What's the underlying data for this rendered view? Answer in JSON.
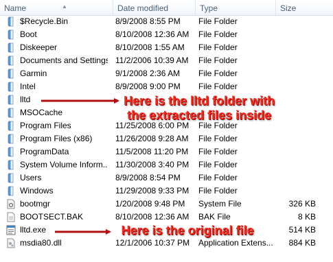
{
  "columns": {
    "name": "Name",
    "date": "Date modified",
    "type": "Type",
    "size": "Size"
  },
  "files": [
    {
      "name": "$Recycle.Bin",
      "date": "8/9/2008 8:55 PM",
      "type": "File Folder",
      "size": "",
      "icon": "folder-icon"
    },
    {
      "name": "Boot",
      "date": "8/10/2008 12:36 AM",
      "type": "File Folder",
      "size": "",
      "icon": "folder-icon"
    },
    {
      "name": "Diskeeper",
      "date": "8/10/2008 1:55 AM",
      "type": "File Folder",
      "size": "",
      "icon": "folder-icon"
    },
    {
      "name": "Documents and Settings",
      "date": "11/2/2006 10:39 AM",
      "type": "File Folder",
      "size": "",
      "icon": "folder-icon"
    },
    {
      "name": "Garmin",
      "date": "9/1/2008 2:36 AM",
      "type": "File Folder",
      "size": "",
      "icon": "folder-icon"
    },
    {
      "name": "Intel",
      "date": "8/9/2008 9:00 PM",
      "type": "File Folder",
      "size": "",
      "icon": "folder-icon"
    },
    {
      "name": "lltd",
      "date": "",
      "type": "",
      "size": "",
      "icon": "folder-icon"
    },
    {
      "name": "MSOCache",
      "date": "",
      "type": "",
      "size": "",
      "icon": "folder-icon"
    },
    {
      "name": "Program Files",
      "date": "11/25/2008 6:00 PM",
      "type": "File Folder",
      "size": "",
      "icon": "folder-icon"
    },
    {
      "name": "Program Files (x86)",
      "date": "11/26/2008 9:28 AM",
      "type": "File Folder",
      "size": "",
      "icon": "folder-icon"
    },
    {
      "name": "ProgramData",
      "date": "11/5/2008 11:20 PM",
      "type": "File Folder",
      "size": "",
      "icon": "folder-icon"
    },
    {
      "name": "System Volume Inform...",
      "date": "11/30/2008 3:40 PM",
      "type": "File Folder",
      "size": "",
      "icon": "folder-icon"
    },
    {
      "name": "Users",
      "date": "8/9/2008 8:54 PM",
      "type": "File Folder",
      "size": "",
      "icon": "folder-icon"
    },
    {
      "name": "Windows",
      "date": "11/29/2008 9:33 PM",
      "type": "File Folder",
      "size": "",
      "icon": "folder-icon"
    },
    {
      "name": "bootmgr",
      "date": "1/20/2008 9:48 PM",
      "type": "System File",
      "size": "326 KB",
      "icon": "system-file-icon"
    },
    {
      "name": "BOOTSECT.BAK",
      "date": "8/10/2008 12:36 AM",
      "type": "BAK File",
      "size": "8 KB",
      "icon": "document-file-icon"
    },
    {
      "name": "lltd.exe",
      "date": "",
      "type": "",
      "size": "514 KB",
      "icon": "executable-file-icon"
    },
    {
      "name": "msdia80.dll",
      "date": "12/1/2006 10:37 PM",
      "type": "Application Extens...",
      "size": "884 KB",
      "icon": "dll-file-icon"
    }
  ],
  "annotations": {
    "folder_callout_line1": "Here is the lltd folder with",
    "folder_callout_line2": "the extracted files inside",
    "file_callout": "Here is the original file"
  },
  "colors": {
    "callout_red": "#ff2a1c",
    "arrow_red": "#b01010",
    "header_text": "#4c607a"
  }
}
